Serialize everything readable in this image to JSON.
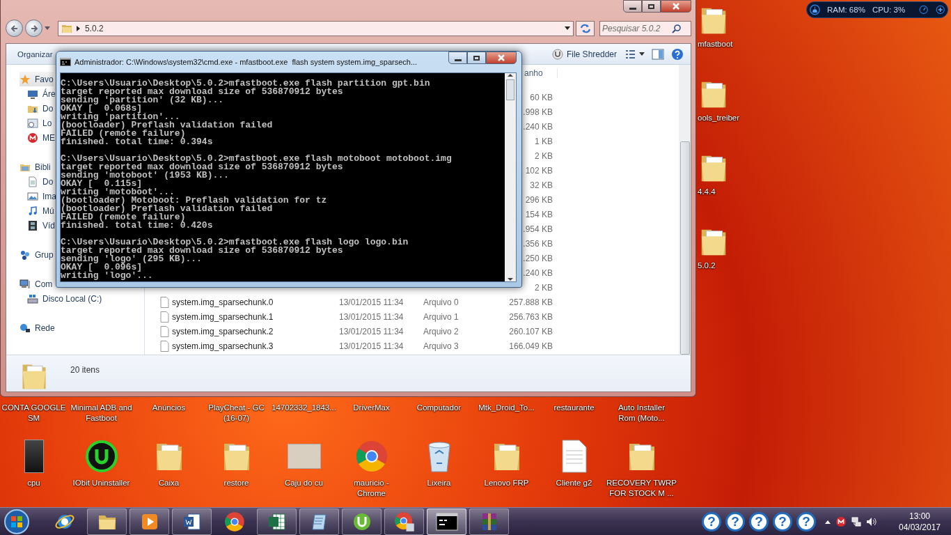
{
  "desktop": {
    "right_column_icons": [
      {
        "label": "mfastboot"
      },
      {
        "label": "ools_treiber"
      },
      {
        "label": "4.4.4"
      },
      {
        "label": "5.0.2"
      }
    ],
    "label_row": [
      {
        "label": "CONTA GOOGLE\nSM"
      },
      {
        "label": "Minimal ADB and\nFastboot"
      },
      {
        "label": "Anúncios"
      },
      {
        "label": "PlayCheat - GC\n(16-07)"
      },
      {
        "label": "14702332_1843..."
      },
      {
        "label": "DriverMax"
      },
      {
        "label": "Computador"
      },
      {
        "label": "Mtk_Droid_To..."
      },
      {
        "label": "restaurante"
      },
      {
        "label": "Auto Installer\nRom (Moto..."
      }
    ],
    "icon_row": [
      {
        "label": "cpu"
      },
      {
        "label": "IObit Uninstaller"
      },
      {
        "label": "Caixa"
      },
      {
        "label": "restore"
      },
      {
        "label": "Caju do cu"
      },
      {
        "label": "mauricio -\nChrome"
      },
      {
        "label": "Lixeira"
      },
      {
        "label": "Lenovo FRP"
      },
      {
        "label": "Cliente g2"
      },
      {
        "label": "RECOVERY TWRP\nFOR STOCK M ..."
      }
    ]
  },
  "gadget": {
    "ram": "RAM: 68%",
    "cpu": "CPU: 3%"
  },
  "explorer": {
    "address": "5.0.2",
    "search": {
      "placeholder": "Pesquisar 5.0.2"
    },
    "toolbar": {
      "organize": "Organizar",
      "file_shredder": "File Shredder"
    },
    "sidebar": [
      {
        "label": "Favo",
        "selected": true,
        "children": [
          {
            "label": "Áre",
            "selected": false
          },
          {
            "label": "Do",
            "selected": false
          },
          {
            "label": "Lo",
            "selected": false
          },
          {
            "label": "ME",
            "selected": false
          }
        ]
      },
      {
        "label": "Bibli",
        "selected": false,
        "children": [
          {
            "label": "Do",
            "selected": false
          },
          {
            "label": "Ima",
            "selected": false
          },
          {
            "label": "Mú",
            "selected": false
          },
          {
            "label": "Víd",
            "selected": false
          }
        ]
      },
      {
        "label": "Grup",
        "selected": false
      },
      {
        "label": "Com",
        "selected": false,
        "children": [
          {
            "label": "Disco Local (C:)",
            "selected": false
          }
        ]
      },
      {
        "label": "Rede",
        "selected": false
      }
    ],
    "size_column_header": "anho",
    "rows": [
      {
        "size": "60 KB"
      },
      {
        "size": ".998 KB"
      },
      {
        "size": ".240 KB"
      },
      {
        "size": "1 KB"
      },
      {
        "size": "2 KB"
      },
      {
        "size": "102 KB"
      },
      {
        "size": "32 KB"
      },
      {
        "size": "296 KB"
      },
      {
        "size": "154 KB"
      },
      {
        "size": ".954 KB"
      },
      {
        "size": ".356 KB"
      },
      {
        "size": ".250 KB"
      },
      {
        "size": ".240 KB"
      },
      {
        "size": "2 KB"
      },
      {
        "name": "system.img_sparsechunk.0",
        "date": "13/01/2015 11:34",
        "type": "Arquivo 0",
        "size": "257.888 KB"
      },
      {
        "name": "system.img_sparsechunk.1",
        "date": "13/01/2015 11:34",
        "type": "Arquivo 1",
        "size": "256.763 KB"
      },
      {
        "name": "system.img_sparsechunk.2",
        "date": "13/01/2015 11:34",
        "type": "Arquivo 2",
        "size": "260.107 KB"
      },
      {
        "name": "system.img_sparsechunk.3",
        "date": "13/01/2015 11:34",
        "type": "Arquivo 3",
        "size": "166.049 KB"
      }
    ],
    "status": "20 itens"
  },
  "cmd": {
    "title": "Administrador: C:\\Windows\\system32\\cmd.exe - mfastboot.exe  flash system system.img_sparsech...",
    "blocks": [
      [
        "C:\\Users\\Usuario\\Desktop\\5.0.2>mfastboot.exe flash partition gpt.bin",
        "target reported max download size of 536870912 bytes",
        "sending 'partition' (32 KB)...",
        "OKAY [  0.068s]",
        "writing 'partition'...",
        "(bootloader) Preflash validation failed",
        "FAILED (remote failure)",
        "finished. total time: 0.394s"
      ],
      [
        "C:\\Users\\Usuario\\Desktop\\5.0.2>mfastboot.exe flash motoboot motoboot.img",
        "target reported max download size of 536870912 bytes",
        "sending 'motoboot' (1953 KB)...",
        "OKAY [  0.115s]",
        "writing 'motoboot'...",
        "(bootloader) Motoboot: Preflash validation for tz",
        "(bootloader) Preflash validation failed",
        "FAILED (remote failure)",
        "finished. total time: 0.420s"
      ],
      [
        "C:\\Users\\Usuario\\Desktop\\5.0.2>mfastboot.exe flash logo logo.bin",
        "target reported max download size of 536870912 bytes",
        "sending 'logo' (295 KB)...",
        "OKAY [  0.096s]",
        "writing 'logo'..."
      ]
    ]
  },
  "taskbar": {
    "items": [
      {
        "running": false,
        "selected": false
      },
      {
        "running": true,
        "selected": false
      },
      {
        "running": true,
        "selected": false
      },
      {
        "running": true,
        "selected": false
      },
      {
        "running": false,
        "selected": false
      },
      {
        "running": true,
        "selected": false
      },
      {
        "running": true,
        "selected": false
      },
      {
        "running": true,
        "selected": false
      },
      {
        "running": true,
        "selected": false
      },
      {
        "running": true,
        "selected": true
      },
      {
        "running": true,
        "selected": false
      }
    ],
    "tray_help": [
      "?",
      "?",
      "?",
      "?",
      "?"
    ],
    "time": "13:00",
    "date": "04/03/2017"
  }
}
